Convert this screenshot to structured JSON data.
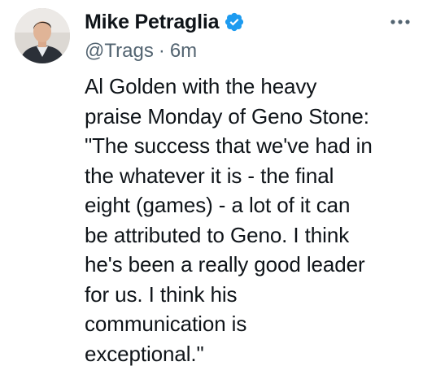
{
  "tweet": {
    "author": {
      "display_name": "Mike Petraglia",
      "handle": "@Trags",
      "verified": true,
      "avatar_icon": "profile-photo"
    },
    "timestamp": "6m",
    "separator": "·",
    "more_icon": "more-options-icon",
    "text": "Al Golden with the heavy\npraise Monday of Geno Stone:\n\"The success that we've had in\nthe whatever it is - the final\neight (games) - a lot of it can\nbe attributed to Geno. I think\nhe's been a really good leader\nfor us. I think his\ncommunication is\nexceptional.\""
  },
  "colors": {
    "verified_badge": "#1d9bf0",
    "secondary_text": "#536471",
    "primary_text": "#0f1419"
  }
}
